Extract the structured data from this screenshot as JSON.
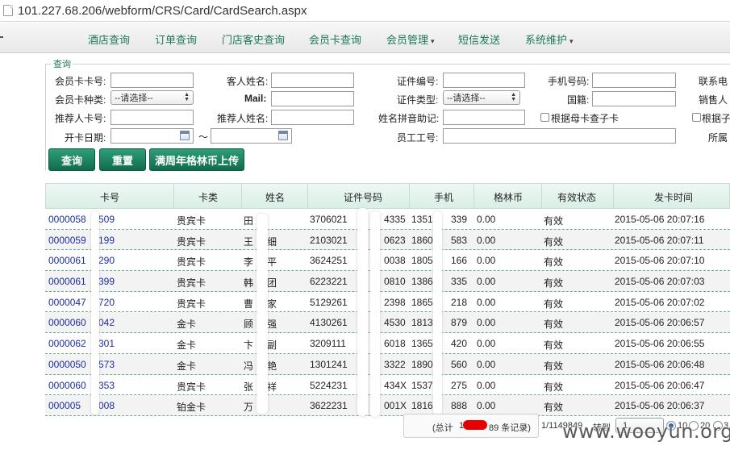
{
  "browser": {
    "url": "101.227.68.206/webform/CRS/Card/CardSearch.aspx"
  },
  "nav": {
    "items": [
      {
        "label": "酒店查询",
        "dropdown": false
      },
      {
        "label": "订单查询",
        "dropdown": false
      },
      {
        "label": "门店客史查询",
        "dropdown": false
      },
      {
        "label": "会员卡查询",
        "dropdown": false
      },
      {
        "label": "会员管理",
        "dropdown": true
      },
      {
        "label": "短信发送",
        "dropdown": false
      },
      {
        "label": "系统维护",
        "dropdown": true
      }
    ],
    "caret": "▾"
  },
  "search": {
    "legend": "查询",
    "card_no": "会员卡卡号:",
    "guest_name": "客人姓名:",
    "id_no": "证件编号:",
    "mobile": "手机号码:",
    "contact": "联系电",
    "card_type": "会员卡种类:",
    "card_type_value": "--请选择--",
    "mail": "Mail:",
    "id_type": "证件类型:",
    "id_type_value": "--请选择--",
    "nationality": "国籍:",
    "salesperson": "销售人",
    "referrer_card": "推荐人卡号:",
    "referrer_name": "推荐人姓名:",
    "pinyin": "姓名拼音助记:",
    "by_parent_card": "根据母卡查子卡",
    "by_child": "根据子",
    "open_date": "开卡日期:",
    "tilde": "～",
    "employee_no": "员工工号:",
    "belong": "所属"
  },
  "buttons": {
    "query": "查询",
    "reset": "重置",
    "upload": "满周年格林币上传"
  },
  "table": {
    "headers": [
      "卡号",
      "卡类",
      "姓名",
      "证件号码",
      "手机",
      "格林币",
      "有效状态",
      "发卡时间"
    ],
    "rows": [
      {
        "card_a": "0000058",
        "card_b": "509",
        "type": "贵宾卡",
        "name_a": "田",
        "name_b": "",
        "id_a": "3706021",
        "id_b": "4335",
        "mob_a": "1351",
        "mob_b": "339",
        "coins": "0.00",
        "status": "有效",
        "time": "2015-05-06 20:07:16"
      },
      {
        "card_a": "0000059",
        "card_b": "199",
        "type": "贵宾卡",
        "name_a": "王",
        "name_b": "细",
        "id_a": "2103021",
        "id_b": "0623",
        "mob_a": "1860",
        "mob_b": "583",
        "coins": "0.00",
        "status": "有效",
        "time": "2015-05-06 20:07:11"
      },
      {
        "card_a": "0000061",
        "card_b": "290",
        "type": "贵宾卡",
        "name_a": "李",
        "name_b": "平",
        "id_a": "3624251",
        "id_b": "0038",
        "mob_a": "1805",
        "mob_b": "166",
        "coins": "0.00",
        "status": "有效",
        "time": "2015-05-06 20:07:10"
      },
      {
        "card_a": "0000061",
        "card_b": "399",
        "type": "贵宾卡",
        "name_a": "韩",
        "name_b": "团",
        "id_a": "6223221",
        "id_b": "0810",
        "mob_a": "1386",
        "mob_b": "335",
        "coins": "0.00",
        "status": "有效",
        "time": "2015-05-06 20:07:03"
      },
      {
        "card_a": "0000047",
        "card_b": "720",
        "type": "贵宾卡",
        "name_a": "曹",
        "name_b": "家",
        "id_a": "5129261",
        "id_b": "2398",
        "mob_a": "1865",
        "mob_b": "218",
        "coins": "0.00",
        "status": "有效",
        "time": "2015-05-06 20:07:02"
      },
      {
        "card_a": "0000060",
        "card_b": "042",
        "type": "金卡",
        "name_a": "顾",
        "name_b": "强",
        "id_a": "4130261",
        "id_b": "4530",
        "mob_a": "1813",
        "mob_b": "879",
        "coins": "0.00",
        "status": "有效",
        "time": "2015-05-06 20:06:57"
      },
      {
        "card_a": "0000062",
        "card_b": "301",
        "type": "金卡",
        "name_a": "卞",
        "name_b": "副",
        "id_a": "3209111",
        "id_b": "6018",
        "mob_a": "1365",
        "mob_b": "420",
        "coins": "0.00",
        "status": "有效",
        "time": "2015-05-06 20:06:55"
      },
      {
        "card_a": "0000050",
        "card_b": "573",
        "type": "金卡",
        "name_a": "冯",
        "name_b": "艳",
        "id_a": "1301241",
        "id_b": "3322",
        "mob_a": "1890",
        "mob_b": "560",
        "coins": "0.00",
        "status": "有效",
        "time": "2015-05-06 20:06:48"
      },
      {
        "card_a": "0000060",
        "card_b": "353",
        "type": "贵宾卡",
        "name_a": "张",
        "name_b": "祥",
        "id_a": "5224231",
        "id_b": "434X",
        "mob_a": "1537",
        "mob_b": "275",
        "coins": "0.00",
        "status": "有效",
        "time": "2015-05-06 20:06:47"
      },
      {
        "card_a": "000005",
        "card_b": "008",
        "type": "铂金卡",
        "name_a": "万",
        "name_b": "",
        "id_a": "3622231",
        "id_b": "001X",
        "mob_a": "1816",
        "mob_b": "888",
        "coins": "0.00",
        "status": "有效",
        "time": "2015-05-06 20:06:37"
      }
    ]
  },
  "pager": {
    "total_prefix": "(总计",
    "total_partial": "1",
    "total_suffix": "89 条记录)",
    "page_info": "1/1149849",
    "jump": "转到",
    "jump_value": "1",
    "size_a": "10",
    "size_b": "20",
    "size_c": "3"
  },
  "watermark": "www.wooyun.org"
}
